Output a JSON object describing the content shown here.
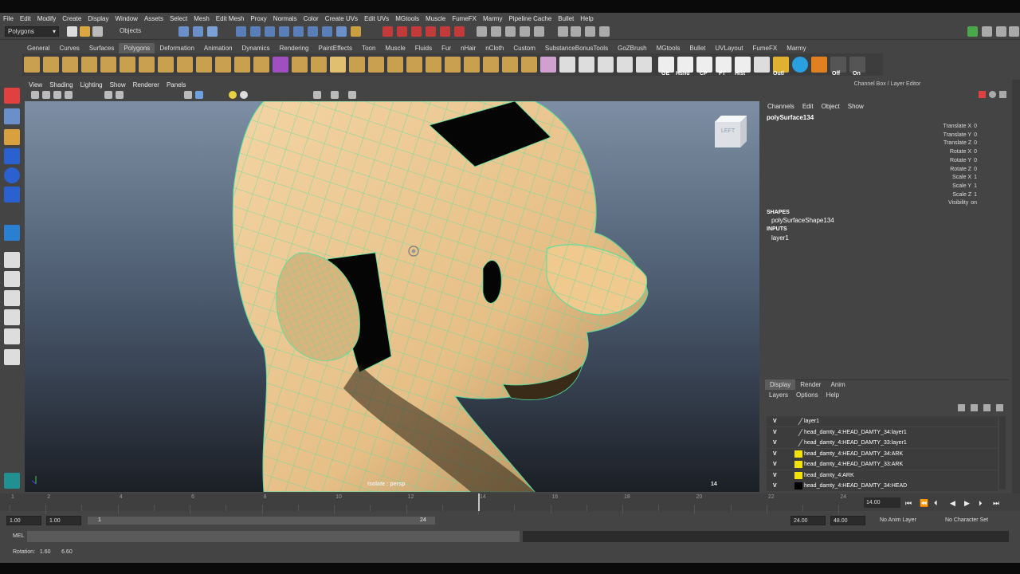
{
  "menubar": [
    "File",
    "Edit",
    "Modify",
    "Create",
    "Display",
    "Window",
    "Assets",
    "Select",
    "Mesh",
    "Edit Mesh",
    "Proxy",
    "Normals",
    "Color",
    "Create UVs",
    "Edit UVs",
    "MGtools",
    "Muscle",
    "FumeFX",
    "Marmy",
    "Pipeline Cache",
    "Bullet",
    "Help"
  ],
  "status": {
    "mode": "Polygons",
    "objects_label": "Objects"
  },
  "shelf_tabs": [
    "General",
    "Curves",
    "Surfaces",
    "Polygons",
    "Deformation",
    "Animation",
    "Dynamics",
    "Rendering",
    "PaintEffects",
    "Toon",
    "Muscle",
    "Fluids",
    "Fur",
    "nHair",
    "nCloth",
    "Custom",
    "SubstanceBonusTools",
    "GoZBrush",
    "MGtools",
    "Bullet",
    "UVLayout",
    "FumeFX",
    "Marmy"
  ],
  "shelf_active": "Polygons",
  "shelf_labels": [
    "GE",
    "Hshd",
    "CP",
    "FT",
    "Hist",
    "Outl",
    "Off",
    "On"
  ],
  "viewport": {
    "menu": [
      "View",
      "Shading",
      "Lighting",
      "Show",
      "Renderer",
      "Panels"
    ],
    "viewcube_label": "LEFT",
    "hud_isolate": "Isolate : persp",
    "hud_frame": "14"
  },
  "channel_box": {
    "title": "Channel Box / Layer Editor",
    "menu": [
      "Channels",
      "Edit",
      "Object",
      "Show"
    ],
    "object": "polySurface134",
    "channels": [
      {
        "name": "Translate X",
        "value": "0"
      },
      {
        "name": "Translate Y",
        "value": "0"
      },
      {
        "name": "Translate Z",
        "value": "0"
      },
      {
        "name": "Rotate X",
        "value": "0"
      },
      {
        "name": "Rotate Y",
        "value": "0"
      },
      {
        "name": "Rotate Z",
        "value": "0"
      },
      {
        "name": "Scale X",
        "value": "1"
      },
      {
        "name": "Scale Y",
        "value": "1"
      },
      {
        "name": "Scale Z",
        "value": "1"
      },
      {
        "name": "Visibility",
        "value": "on"
      }
    ],
    "shapes_header": "SHAPES",
    "shape": "polySurfaceShape134",
    "inputs_header": "INPUTS",
    "input": "layer1"
  },
  "layer_editor": {
    "tabs": [
      "Display",
      "Render",
      "Anim"
    ],
    "menu": [
      "Layers",
      "Options",
      "Help"
    ],
    "layers": [
      {
        "vis": "V",
        "name": "layer1",
        "color": ""
      },
      {
        "vis": "V",
        "name": "head_damty_4:HEAD_DAMTY_34:layer1",
        "color": ""
      },
      {
        "vis": "V",
        "name": "head_damty_4:HEAD_DAMTY_33:layer1",
        "color": ""
      },
      {
        "vis": "V",
        "name": "head_damty_4:HEAD_DAMTY_34:ARK",
        "color": "#f2e400"
      },
      {
        "vis": "V",
        "name": "head_damty_4:HEAD_DAMTY_33:ARK",
        "color": "#f2e400"
      },
      {
        "vis": "V",
        "name": "head_damty_4:ARK",
        "color": "#f2e400"
      },
      {
        "vis": "V",
        "name": "head_damty_4:HEAD_DAMTY_34:HEAD",
        "color": "#000000"
      }
    ]
  },
  "timeline": {
    "ticks": [
      "1",
      "2",
      "4",
      "6",
      "8",
      "10",
      "12",
      "14",
      "16",
      "18",
      "20",
      "22",
      "24"
    ],
    "current_frame": "14.00"
  },
  "range": {
    "start": "1.00",
    "start2": "1.00",
    "range_start": "1",
    "range_end": "24",
    "end": "24.00",
    "end2": "48.00",
    "anim_layer": "No Anim Layer",
    "char_set": "No Character Set"
  },
  "cmdline": {
    "label": "MEL"
  },
  "helpline": {
    "text": "Rotation:   1.60       6.60"
  }
}
